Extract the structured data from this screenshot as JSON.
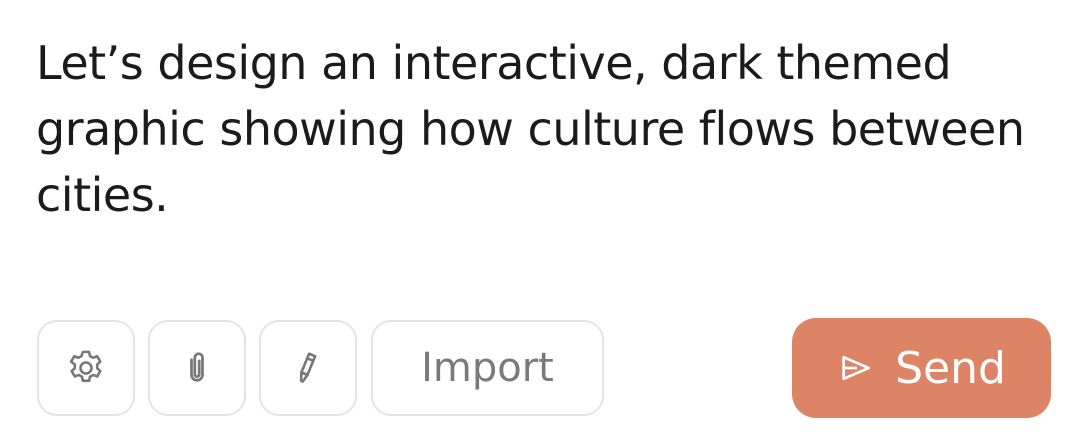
{
  "composer": {
    "prompt_text": "Let’s design an interactive, dark themed graphic showing how culture flows between cities."
  },
  "toolbar": {
    "settings_icon": "gear-icon",
    "attach_icon": "paperclip-icon",
    "edit_icon": "pencil-icon",
    "import_label": "Import",
    "send_label": "Send",
    "send_icon": "send-icon"
  },
  "colors": {
    "text": "#1b1b1b",
    "muted_text": "#7a7a7a",
    "border": "#e4e4e4",
    "send_background": "#de8466",
    "send_text": "#ffffff"
  }
}
